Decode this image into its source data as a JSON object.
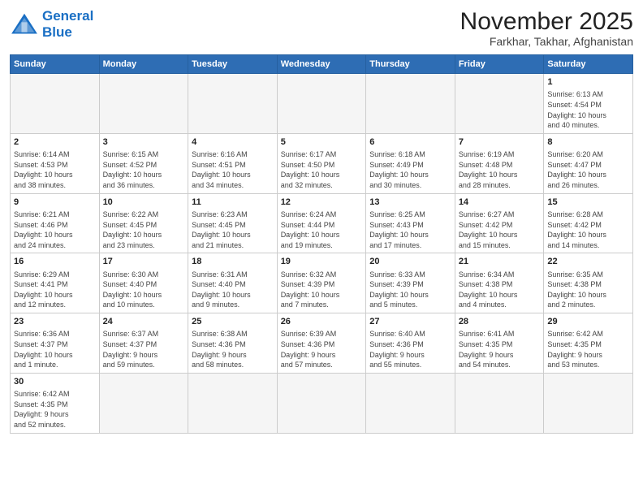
{
  "header": {
    "logo_line1": "General",
    "logo_line2": "Blue",
    "month": "November 2025",
    "location": "Farkhar, Takhar, Afghanistan"
  },
  "weekdays": [
    "Sunday",
    "Monday",
    "Tuesday",
    "Wednesday",
    "Thursday",
    "Friday",
    "Saturday"
  ],
  "weeks": [
    [
      {
        "day": "",
        "info": ""
      },
      {
        "day": "",
        "info": ""
      },
      {
        "day": "",
        "info": ""
      },
      {
        "day": "",
        "info": ""
      },
      {
        "day": "",
        "info": ""
      },
      {
        "day": "",
        "info": ""
      },
      {
        "day": "1",
        "info": "Sunrise: 6:13 AM\nSunset: 4:54 PM\nDaylight: 10 hours\nand 40 minutes."
      }
    ],
    [
      {
        "day": "2",
        "info": "Sunrise: 6:14 AM\nSunset: 4:53 PM\nDaylight: 10 hours\nand 38 minutes."
      },
      {
        "day": "3",
        "info": "Sunrise: 6:15 AM\nSunset: 4:52 PM\nDaylight: 10 hours\nand 36 minutes."
      },
      {
        "day": "4",
        "info": "Sunrise: 6:16 AM\nSunset: 4:51 PM\nDaylight: 10 hours\nand 34 minutes."
      },
      {
        "day": "5",
        "info": "Sunrise: 6:17 AM\nSunset: 4:50 PM\nDaylight: 10 hours\nand 32 minutes."
      },
      {
        "day": "6",
        "info": "Sunrise: 6:18 AM\nSunset: 4:49 PM\nDaylight: 10 hours\nand 30 minutes."
      },
      {
        "day": "7",
        "info": "Sunrise: 6:19 AM\nSunset: 4:48 PM\nDaylight: 10 hours\nand 28 minutes."
      },
      {
        "day": "8",
        "info": "Sunrise: 6:20 AM\nSunset: 4:47 PM\nDaylight: 10 hours\nand 26 minutes."
      }
    ],
    [
      {
        "day": "9",
        "info": "Sunrise: 6:21 AM\nSunset: 4:46 PM\nDaylight: 10 hours\nand 24 minutes."
      },
      {
        "day": "10",
        "info": "Sunrise: 6:22 AM\nSunset: 4:45 PM\nDaylight: 10 hours\nand 23 minutes."
      },
      {
        "day": "11",
        "info": "Sunrise: 6:23 AM\nSunset: 4:45 PM\nDaylight: 10 hours\nand 21 minutes."
      },
      {
        "day": "12",
        "info": "Sunrise: 6:24 AM\nSunset: 4:44 PM\nDaylight: 10 hours\nand 19 minutes."
      },
      {
        "day": "13",
        "info": "Sunrise: 6:25 AM\nSunset: 4:43 PM\nDaylight: 10 hours\nand 17 minutes."
      },
      {
        "day": "14",
        "info": "Sunrise: 6:27 AM\nSunset: 4:42 PM\nDaylight: 10 hours\nand 15 minutes."
      },
      {
        "day": "15",
        "info": "Sunrise: 6:28 AM\nSunset: 4:42 PM\nDaylight: 10 hours\nand 14 minutes."
      }
    ],
    [
      {
        "day": "16",
        "info": "Sunrise: 6:29 AM\nSunset: 4:41 PM\nDaylight: 10 hours\nand 12 minutes."
      },
      {
        "day": "17",
        "info": "Sunrise: 6:30 AM\nSunset: 4:40 PM\nDaylight: 10 hours\nand 10 minutes."
      },
      {
        "day": "18",
        "info": "Sunrise: 6:31 AM\nSunset: 4:40 PM\nDaylight: 10 hours\nand 9 minutes."
      },
      {
        "day": "19",
        "info": "Sunrise: 6:32 AM\nSunset: 4:39 PM\nDaylight: 10 hours\nand 7 minutes."
      },
      {
        "day": "20",
        "info": "Sunrise: 6:33 AM\nSunset: 4:39 PM\nDaylight: 10 hours\nand 5 minutes."
      },
      {
        "day": "21",
        "info": "Sunrise: 6:34 AM\nSunset: 4:38 PM\nDaylight: 10 hours\nand 4 minutes."
      },
      {
        "day": "22",
        "info": "Sunrise: 6:35 AM\nSunset: 4:38 PM\nDaylight: 10 hours\nand 2 minutes."
      }
    ],
    [
      {
        "day": "23",
        "info": "Sunrise: 6:36 AM\nSunset: 4:37 PM\nDaylight: 10 hours\nand 1 minute."
      },
      {
        "day": "24",
        "info": "Sunrise: 6:37 AM\nSunset: 4:37 PM\nDaylight: 9 hours\nand 59 minutes."
      },
      {
        "day": "25",
        "info": "Sunrise: 6:38 AM\nSunset: 4:36 PM\nDaylight: 9 hours\nand 58 minutes."
      },
      {
        "day": "26",
        "info": "Sunrise: 6:39 AM\nSunset: 4:36 PM\nDaylight: 9 hours\nand 57 minutes."
      },
      {
        "day": "27",
        "info": "Sunrise: 6:40 AM\nSunset: 4:36 PM\nDaylight: 9 hours\nand 55 minutes."
      },
      {
        "day": "28",
        "info": "Sunrise: 6:41 AM\nSunset: 4:35 PM\nDaylight: 9 hours\nand 54 minutes."
      },
      {
        "day": "29",
        "info": "Sunrise: 6:42 AM\nSunset: 4:35 PM\nDaylight: 9 hours\nand 53 minutes."
      }
    ],
    [
      {
        "day": "30",
        "info": "Sunrise: 6:42 AM\nSunset: 4:35 PM\nDaylight: 9 hours\nand 52 minutes."
      },
      {
        "day": "",
        "info": ""
      },
      {
        "day": "",
        "info": ""
      },
      {
        "day": "",
        "info": ""
      },
      {
        "day": "",
        "info": ""
      },
      {
        "day": "",
        "info": ""
      },
      {
        "day": "",
        "info": ""
      }
    ]
  ]
}
